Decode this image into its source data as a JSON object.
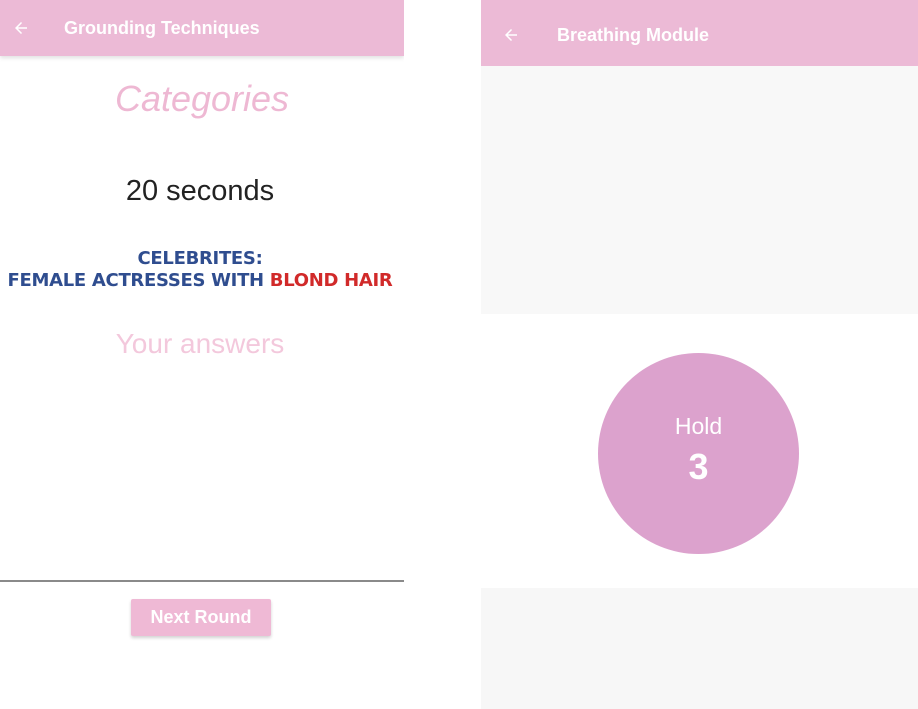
{
  "left_screen": {
    "appbar": {
      "title": "Grounding Techniques",
      "back_icon": "arrow-left-icon",
      "color": "#ecbad6"
    },
    "title": "Categories",
    "timer": "20 seconds",
    "prompt": {
      "line1": "CELEBRITES:",
      "line2_part1": "FEMALE ACTRESSES WITH ",
      "line2_highlight": "BLOND HAIR"
    },
    "answers_placeholder": "Your answers",
    "next_button": "Next Round"
  },
  "right_screen": {
    "appbar": {
      "title": "Breathing Module",
      "back_icon": "arrow-left-icon",
      "color": "#ecbad6"
    },
    "breath": {
      "phase": "Hold",
      "count": "3",
      "circle_color": "#dca2cd"
    }
  },
  "colors": {
    "prompt_blue": "#2f4d8f",
    "prompt_red": "#d12a2a",
    "accent_pink": "#efb9d5"
  }
}
